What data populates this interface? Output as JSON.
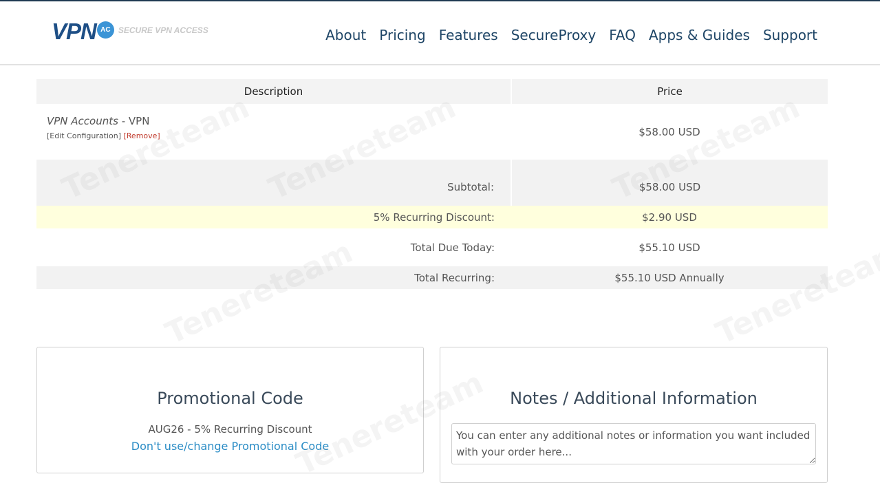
{
  "header": {
    "logo_text": "VPN",
    "logo_badge": "AC",
    "logo_tagline": "SECURE VPN ACCESS",
    "nav": [
      "About",
      "Pricing",
      "Features",
      "SecureProxy",
      "FAQ",
      "Apps & Guides",
      "Support"
    ]
  },
  "summary": {
    "columns": {
      "description": "Description",
      "price": "Price"
    },
    "item": {
      "name_italic": "VPN Accounts",
      "name_suffix": " - VPN",
      "edit_label": "[Edit Configuration]",
      "remove_label": "[Remove]",
      "price": "$58.00 USD"
    },
    "subtotal": {
      "label": "Subtotal:",
      "value": "$58.00 USD"
    },
    "discount": {
      "label": "5% Recurring Discount:",
      "value": "$2.90 USD"
    },
    "total_due": {
      "label": "Total Due Today:",
      "value": "$55.10 USD"
    },
    "total_recurring": {
      "label": "Total Recurring:",
      "value": "$55.10 USD Annually"
    }
  },
  "promo": {
    "title": "Promotional Code",
    "applied": "AUG26 - 5% Recurring Discount",
    "change_link": "Don't use/change Promotional Code"
  },
  "notes": {
    "title": "Notes / Additional Information",
    "placeholder": "You can enter any additional notes or information you want included with your order here..."
  },
  "watermark": "Tenereteam",
  "colors": {
    "nav": "#1e4566",
    "logo": "#1e4f86",
    "link": "#2a8cc5",
    "remove": "#c0392b",
    "discount_row": "#ffffdd"
  }
}
